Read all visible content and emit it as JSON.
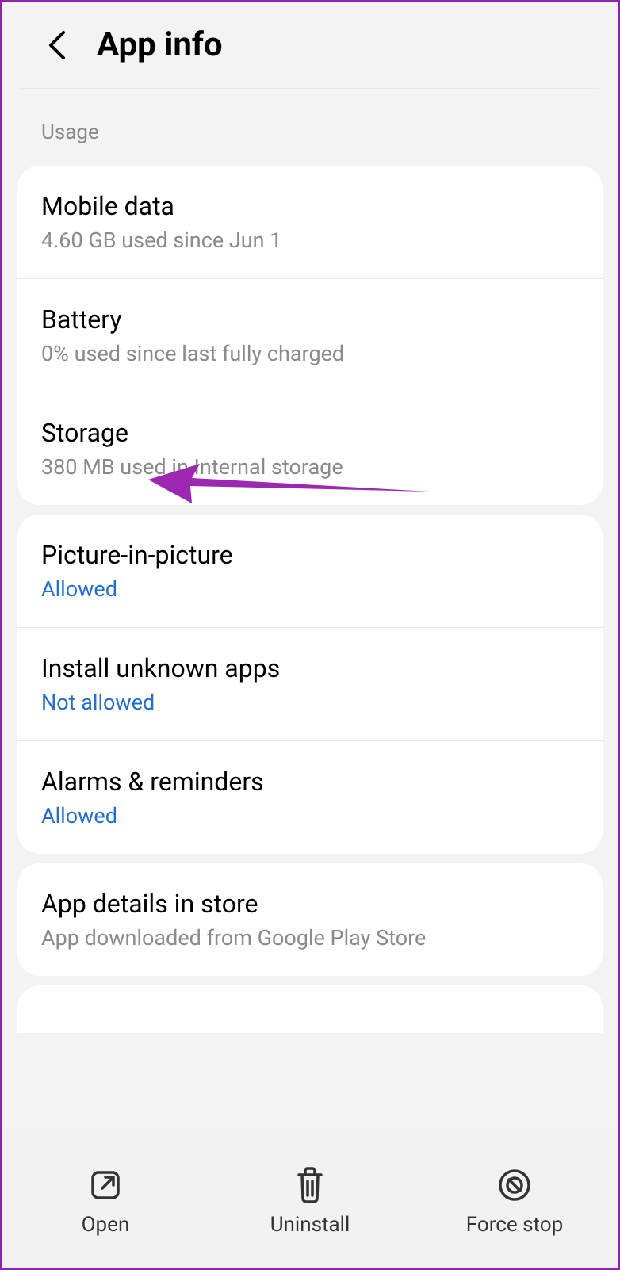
{
  "header": {
    "title": "App info"
  },
  "usage_section": {
    "label": "Usage",
    "items": [
      {
        "title": "Mobile data",
        "subtitle": "4.60 GB used since Jun 1"
      },
      {
        "title": "Battery",
        "subtitle": "0% used since last fully charged"
      },
      {
        "title": "Storage",
        "subtitle": "380 MB used in Internal storage"
      }
    ]
  },
  "permissions_section": {
    "items": [
      {
        "title": "Picture-in-picture",
        "subtitle": "Allowed"
      },
      {
        "title": "Install unknown apps",
        "subtitle": "Not allowed"
      },
      {
        "title": "Alarms & reminders",
        "subtitle": "Allowed"
      }
    ]
  },
  "store_section": {
    "items": [
      {
        "title": "App details in store",
        "subtitle": "App downloaded from Google Play Store"
      }
    ]
  },
  "bottom_bar": {
    "open": "Open",
    "uninstall": "Uninstall",
    "force_stop": "Force stop"
  }
}
